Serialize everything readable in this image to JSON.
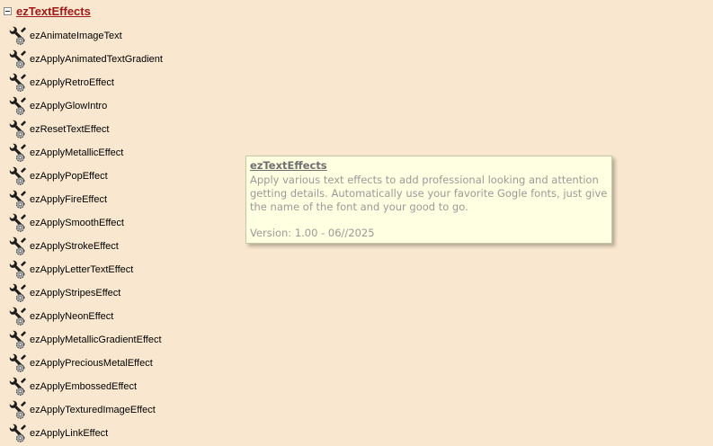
{
  "library": {
    "title": "ezTextEffects",
    "collapse_icon": "minus-box-icon"
  },
  "functions": [
    "ezAnimateImageText",
    "ezApplyAnimatedTextGradient",
    "ezApplyRetroEffect",
    "ezApplyGlowIntro",
    "ezResetTextEffect",
    "ezApplyMetallicEffect",
    "ezApplyPopEffect",
    "ezApplyFireEffect",
    "ezApplySmoothEffect",
    "ezApplyStrokeEffect",
    "ezApplyLetterTextEffect",
    "ezApplyStripesEffect",
    "ezApplyNeonEffect",
    "ezApplyMetallicGradientEffect",
    "ezApplyPreciousMetalEffect",
    "ezApplyEmbossedEffect",
    "ezApplyTexturedImageEffect",
    "ezApplyLinkEffect"
  ],
  "function_icon": "wrench-gear-icon",
  "tooltip": {
    "title": "ezTextEffects",
    "description": "Apply various text effects to add professional looking and attention getting details. Automatically use your favorite Gogle fonts, just give the name of the font and your good to go.",
    "version": "Version: 1.00 - 06//2025"
  },
  "colors": {
    "background": "#f9e8cf",
    "title": "#a11818",
    "tooltip_bg": "#ffffe1"
  }
}
